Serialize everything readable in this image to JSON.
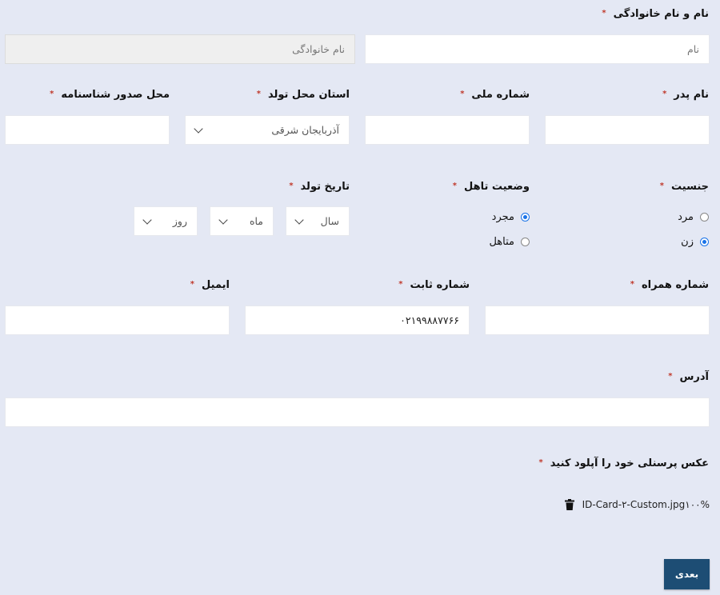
{
  "labels": {
    "full_name": "نام و نام خانوادگی",
    "father_name": "نام پدر",
    "national_code": "شماره ملی",
    "birth_province": "استان محل تولد",
    "id_issue_place": "محل صدور شناسنامه",
    "gender": "جنسیت",
    "marital_status": "وضعیت تاهل",
    "birth_date": "تاریخ تولد",
    "mobile": "شماره همراه",
    "phone": "شماره ثابت",
    "email": "ایمیل",
    "address": "آدرس",
    "upload_photo": "عکس پرسنلی خود را آپلود کنید"
  },
  "required_mark": "*",
  "fields": {
    "first_name_placeholder": "نام",
    "last_name_placeholder": "نام خانوادگی",
    "father_name_value": "",
    "national_code_value": "",
    "birth_province_value": "آذربایجان شرقی",
    "id_issue_place_value": "",
    "birth_year": "سال",
    "birth_month": "ماه",
    "birth_day": "روز",
    "mobile_value": "",
    "phone_value": "۰۲۱۹۹۸۸۷۷۶۶",
    "email_value": "",
    "address_value": ""
  },
  "gender_options": [
    {
      "label": "مرد",
      "selected": false
    },
    {
      "label": "زن",
      "selected": true
    }
  ],
  "marital_options": [
    {
      "label": "مجرد",
      "selected": true
    },
    {
      "label": "متاهل",
      "selected": false
    }
  ],
  "upload": {
    "file_name": "ID-Card-۲-Custom.jpg",
    "progress_text": "۱۰۰%",
    "delete_icon": "trash-icon"
  },
  "next_button": "بعدی",
  "colors": {
    "background": "#e4e8f4",
    "required": "#c0392b",
    "radio_accent": "#1a73e8",
    "button": "#1d4d74"
  }
}
